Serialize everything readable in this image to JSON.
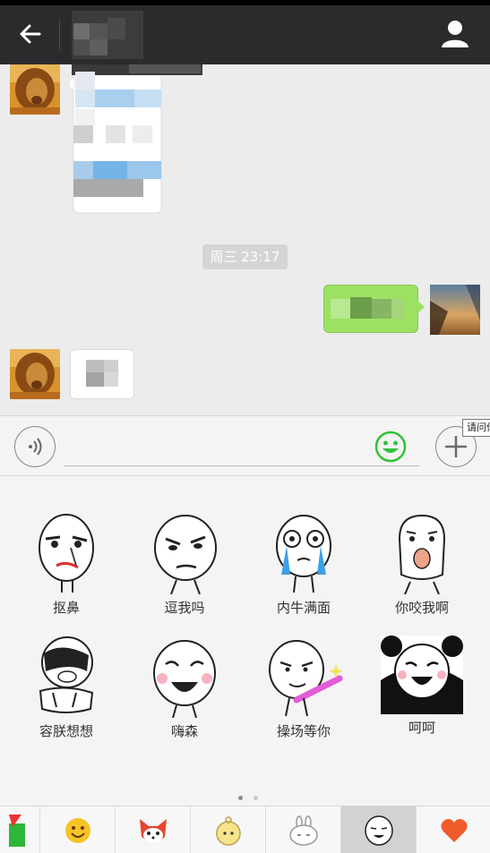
{
  "header": {
    "back_icon": "back-arrow-icon",
    "profile_icon": "person-icon"
  },
  "chat": {
    "timestamp": "周三 23:17"
  },
  "input_bar": {
    "message_value": "",
    "voice_icon": "voice-icon",
    "emoji_icon": "smiley-icon",
    "plus_icon": "plus-icon",
    "tooltip": "请问你"
  },
  "stickers": [
    {
      "label": "抠鼻"
    },
    {
      "label": "逗我吗"
    },
    {
      "label": "内牛满面"
    },
    {
      "label": "你咬我啊"
    },
    {
      "label": "容朕想想"
    },
    {
      "label": "嗨森"
    },
    {
      "label": "操场等你"
    },
    {
      "label": "呵呵"
    }
  ],
  "pager": {
    "page": 1,
    "total": 2
  },
  "tabs": [
    {
      "icon": "store-bag-icon"
    },
    {
      "icon": "emoji-face-icon"
    },
    {
      "icon": "fox-icon"
    },
    {
      "icon": "baby-icon"
    },
    {
      "icon": "rabbit-icon"
    },
    {
      "icon": "meme-face-icon",
      "selected": true
    },
    {
      "icon": "heart-icon"
    }
  ],
  "colors": {
    "titlebar": "#2b2b2d",
    "sent_bubble": "#9de162",
    "emoji_green": "#2fc23a"
  }
}
